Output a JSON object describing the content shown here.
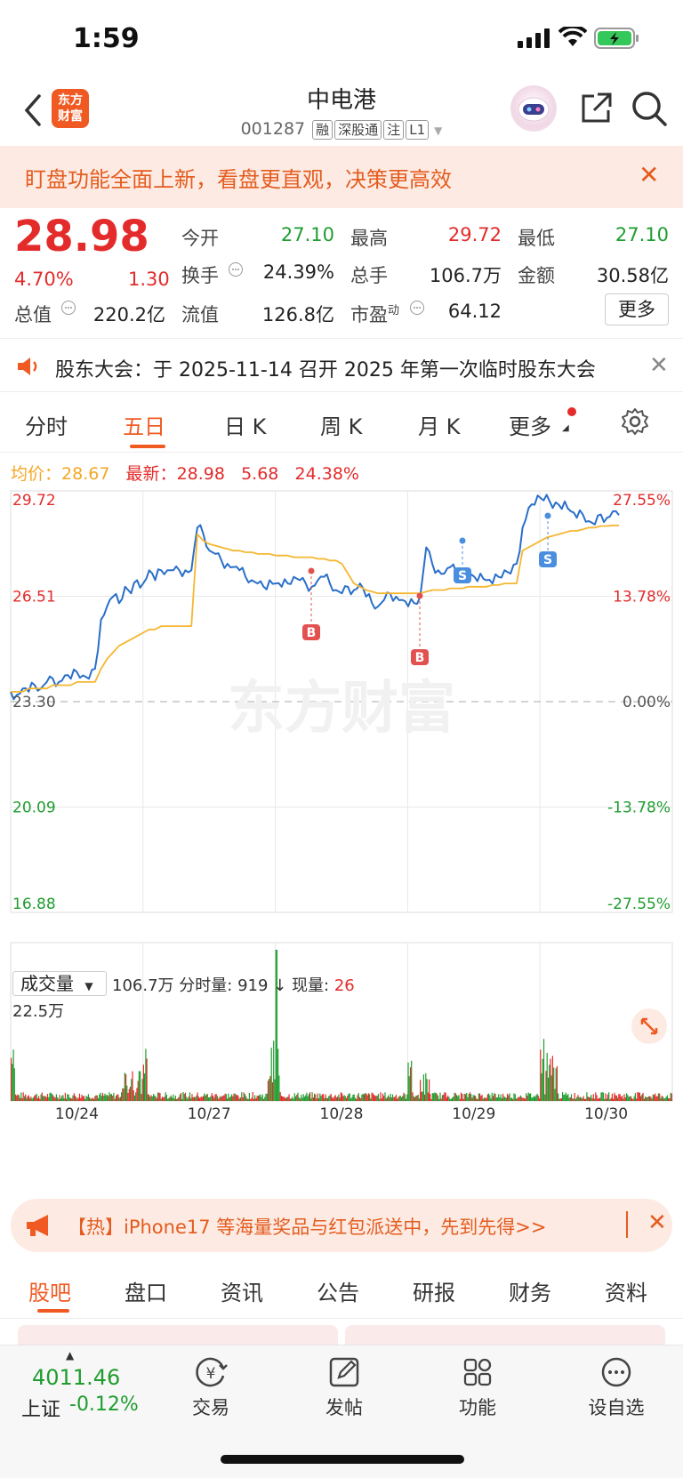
{
  "status": {
    "time": "1:59"
  },
  "header": {
    "logo_line1": "东方",
    "logo_line2": "财富",
    "name": "中电港",
    "code": "001287",
    "tags": [
      "融",
      "深股通",
      "注",
      "L1"
    ]
  },
  "banner": {
    "text": "盯盘功能全面上新，看盘更直观，决策更高效",
    "close": "✕"
  },
  "quote": {
    "price": "28.98",
    "pct": "4.70%",
    "change": "1.30",
    "open_label": "今开",
    "open": "27.10",
    "high_label": "最高",
    "high": "29.72",
    "low_label": "最低",
    "low": "27.10",
    "turnover_label": "换手",
    "turnover": "24.39%",
    "volume_label": "总手",
    "volume": "106.7万",
    "amount_label": "金额",
    "amount": "30.58亿",
    "mktcap_label": "总值",
    "mktcap": "220.2亿",
    "float_label": "流值",
    "float": "126.8亿",
    "pe_label": "市盈",
    "pe_sup": "动",
    "pe": "64.12",
    "more": "更多"
  },
  "notice": {
    "text": "股东大会：于 2025-11-14 召开 2025 年第一次临时股东大会",
    "close": "✕"
  },
  "chart_tabs": [
    "分时",
    "五日",
    "日 K",
    "周 K",
    "月 K",
    "更多"
  ],
  "legend": {
    "avg_label": "均价：",
    "avg": "28.67",
    "latest_label": "最新：",
    "latest": "28.98",
    "chg": "5.68",
    "pct": "24.38%"
  },
  "chart_data": {
    "type": "line",
    "left_ticks": [
      "29.72",
      "26.51",
      "23.30",
      "20.09",
      "16.88"
    ],
    "right_ticks": [
      "27.55%",
      "13.78%",
      "0.00%",
      "-13.78%",
      "-27.55%"
    ],
    "ylim": [
      16.88,
      29.72
    ],
    "base": 23.3,
    "x_labels": [
      "10/24",
      "10/27",
      "10/28",
      "10/29",
      "10/30"
    ],
    "watermark": "东方财富",
    "series": [
      {
        "values": [
          23.6,
          23.5,
          23.7,
          23.6,
          23.8,
          23.7,
          23.9,
          24.0,
          23.9,
          24.1,
          24.0,
          24.2,
          24.1,
          24.0,
          24.3,
          25.8,
          26.2,
          26.5,
          26.3,
          26.8,
          26.6,
          27.0,
          26.9,
          27.3,
          27.0,
          27.3,
          27.3,
          27.3,
          27.3,
          27.3,
          27.3,
          28.6,
          28.4,
          27.9,
          27.8,
          27.6,
          27.5,
          27.4,
          27.3,
          27.1,
          27.0,
          26.9,
          26.8,
          27.0,
          26.9,
          26.8,
          26.9,
          27.1,
          27.0,
          26.9,
          26.8,
          27.0,
          27.1,
          26.9,
          26.7,
          26.6,
          26.8,
          26.7,
          26.9,
          26.5,
          26.3,
          26.2,
          26.4,
          26.6,
          26.5,
          26.4,
          26.2,
          26.3,
          26.5,
          28.0,
          27.5,
          27.3,
          27.2,
          27.4,
          27.2,
          27.1,
          27.0,
          27.1,
          27.2,
          27.0,
          26.9,
          27.1,
          27.3,
          27.2,
          27.5,
          28.6,
          29.2,
          29.3,
          29.5,
          29.6,
          29.2,
          29.3,
          29.4,
          29.1,
          28.9,
          29.0,
          28.8,
          28.7,
          29.0,
          28.9,
          29.1,
          28.98
        ]
      },
      {
        "values": [
          23.6,
          23.6,
          23.6,
          23.7,
          23.7,
          23.7,
          23.7,
          23.8,
          23.8,
          23.8,
          23.8,
          23.9,
          23.9,
          23.9,
          23.9,
          24.3,
          24.6,
          24.8,
          25.0,
          25.1,
          25.2,
          25.3,
          25.4,
          25.5,
          25.5,
          25.6,
          25.6,
          25.6,
          25.6,
          25.6,
          25.6,
          28.4,
          28.2,
          28.1,
          28.05,
          28.0,
          27.95,
          27.9,
          27.9,
          27.85,
          27.85,
          27.8,
          27.8,
          27.8,
          27.75,
          27.75,
          27.75,
          27.7,
          27.7,
          27.7,
          27.7,
          27.65,
          27.65,
          27.6,
          27.6,
          27.5,
          27.2,
          26.9,
          26.8,
          26.7,
          26.65,
          26.6,
          26.6,
          26.6,
          26.6,
          26.6,
          26.6,
          26.6,
          26.6,
          26.65,
          26.7,
          26.7,
          26.7,
          26.75,
          26.75,
          26.75,
          26.8,
          26.8,
          26.8,
          26.8,
          26.85,
          26.85,
          26.9,
          26.9,
          26.9,
          27.9,
          28.0,
          28.1,
          28.2,
          28.3,
          28.35,
          28.4,
          28.45,
          28.5,
          28.5,
          28.55,
          28.6,
          28.6,
          28.65,
          28.65,
          28.67,
          28.67
        ]
      }
    ],
    "volume_ylabel": "22.5万"
  },
  "volume": {
    "select": "成交量",
    "total": "106.7万",
    "fs_label": "分时量:",
    "fs_val": "919",
    "arrow": "↓",
    "now_label": "现量:",
    "now_val": "26"
  },
  "promo": {
    "text": "【热】iPhone17 等海量奖品与红包派送中，先到先得>>",
    "close": "✕"
  },
  "bottom_tabs": [
    "股吧",
    "盘口",
    "资讯",
    "公告",
    "研报",
    "财务",
    "资料"
  ],
  "toolbar": {
    "index_value": "4011.46",
    "index_name": "上证",
    "index_change": "-0.12%",
    "items": [
      "交易",
      "发帖",
      "功能",
      "设自选"
    ]
  },
  "colors": {
    "accent": "#f05a22",
    "up": "#e32b2b",
    "down": "#1f9d2f",
    "price_line": "#2a6fc9",
    "avg_line": "#f5b731"
  }
}
